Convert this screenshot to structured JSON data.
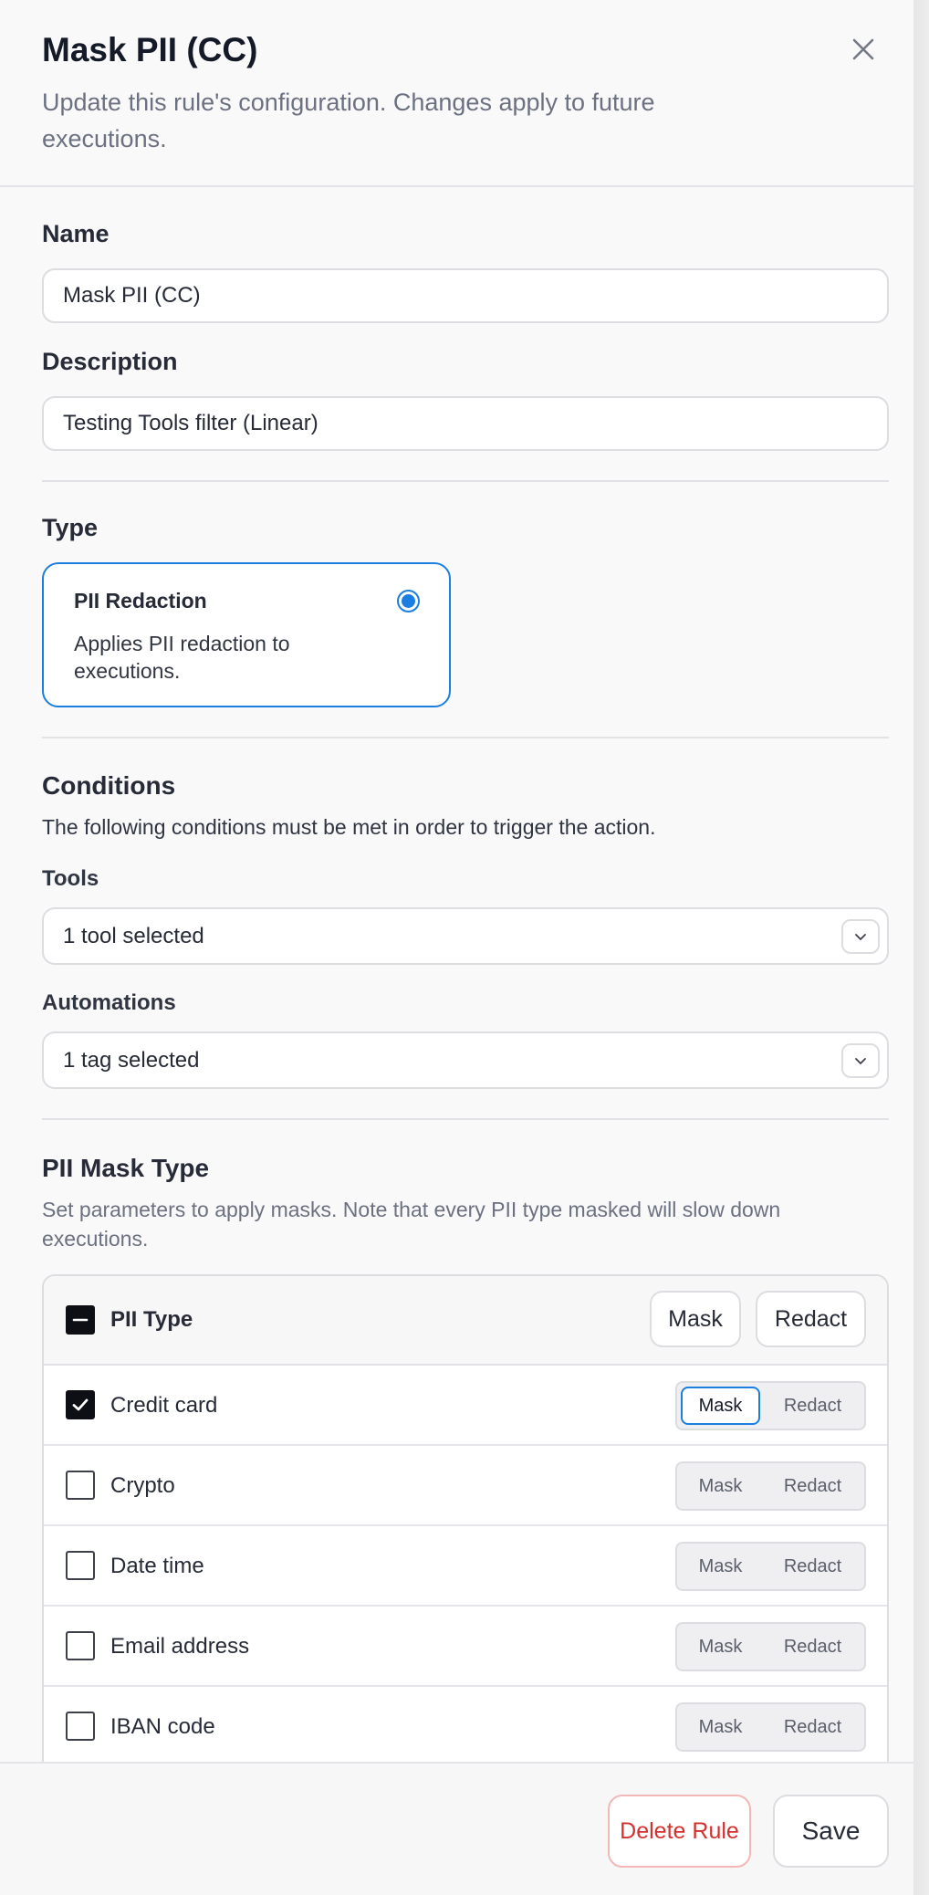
{
  "dialog": {
    "title": "Mask PII (CC)",
    "subtitle": "Update this rule's configuration. Changes apply to future executions."
  },
  "name": {
    "label": "Name",
    "value": "Mask PII (CC)"
  },
  "description": {
    "label": "Description",
    "value": "Testing Tools filter (Linear)"
  },
  "type": {
    "label": "Type",
    "option": {
      "title": "PII Redaction",
      "text": "Applies PII redaction to executions.",
      "selected": true
    }
  },
  "conditions": {
    "title": "Conditions",
    "description": "The following conditions must be met in order to trigger the action.",
    "tools": {
      "label": "Tools",
      "value": "1 tool selected"
    },
    "automations": {
      "label": "Automations",
      "value": "1 tag selected"
    }
  },
  "pii": {
    "title": "PII Mask Type",
    "description": "Set parameters to apply masks. Note that every PII type masked will slow down executions.",
    "header": {
      "label": "PII Type",
      "mask": "Mask",
      "redact": "Redact"
    },
    "mask_label": "Mask",
    "redact_label": "Redact",
    "rows": [
      {
        "label": "Credit card",
        "checked": true,
        "mode": "Mask"
      },
      {
        "label": "Crypto",
        "checked": false,
        "mode": ""
      },
      {
        "label": "Date time",
        "checked": false,
        "mode": ""
      },
      {
        "label": "Email address",
        "checked": false,
        "mode": ""
      },
      {
        "label": "IBAN code",
        "checked": false,
        "mode": ""
      }
    ]
  },
  "footer": {
    "delete": "Delete Rule",
    "save": "Save"
  },
  "colors": {
    "accent": "#1a7fe0",
    "danger": "#d3312f"
  }
}
